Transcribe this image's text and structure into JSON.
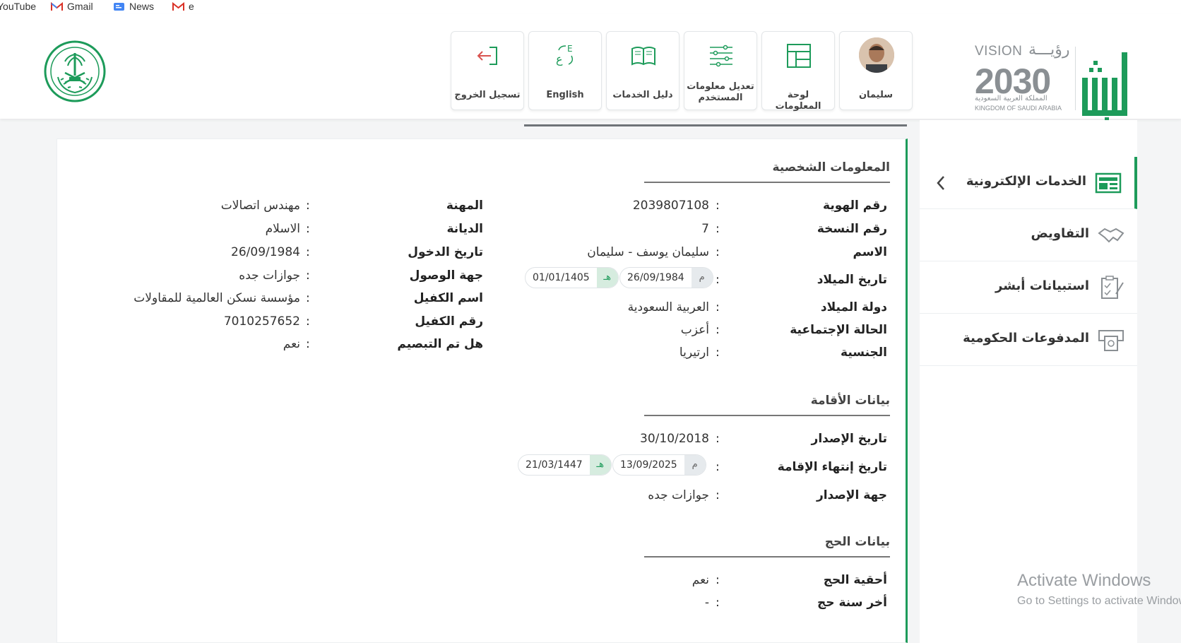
{
  "bookmarks": [
    {
      "label": "YouTube",
      "icon": "youtube-icon"
    },
    {
      "label": "Gmail",
      "icon": "gmail-icon"
    },
    {
      "label": "News",
      "icon": "news-icon"
    },
    {
      "label": "e",
      "icon": "gmail-icon"
    }
  ],
  "brand": {
    "vision_word": "VISION",
    "vision_ar": "رؤيـــة",
    "vision_year": "2030",
    "kingdom_ar": "المملكة العربية السعودية",
    "kingdom_en": "KINGDOM OF SAUDI ARABIA",
    "accent": "#1d9b5a"
  },
  "tiles": {
    "user": "سليمان",
    "dashboard": "لوحة المعلومات",
    "edit_info": "تعديل معلومات المستخدم",
    "services_guide": "دليل الخدمات",
    "language": "English",
    "logout": "تسجيل الخروج"
  },
  "sidebar": {
    "items": [
      {
        "label": "الخدمات الإلكترونية",
        "icon": "eservices-icon"
      },
      {
        "label": "التفاويض",
        "icon": "handshake-icon"
      },
      {
        "label": "استبيانات أبشر",
        "icon": "survey-icon"
      },
      {
        "label": "المدفوعات الحكومية",
        "icon": "payments-icon"
      }
    ]
  },
  "personal": {
    "title": "المعلومات الشخصية",
    "id_label": "رقم الهوية",
    "id_value": "2039807108",
    "copy_label": "رقم النسخة",
    "copy_value": "7",
    "name_label": "الاسم",
    "name_value": "سليمان يوسف - سليمان",
    "dob_label": "تاريخ الميلاد",
    "dob_greg_tag": "م",
    "dob_greg": "26/09/1984",
    "dob_hijri_tag": "هـ",
    "dob_hijri": "01/01/1405",
    "birth_country_label": "دولة الميلاد",
    "birth_country_value": "العربية السعودية",
    "marital_label": "الحالة الإجتماعية",
    "marital_value": "أعزب",
    "nationality_label": "الجنسية",
    "nationality_value": "ارتيريا",
    "occupation_label": "المهنة",
    "occupation_value": "مهندس اتصالات",
    "religion_label": "الديانة",
    "religion_value": "الاسلام",
    "entry_label": "تاريخ الدخول",
    "entry_value": "26/09/1984",
    "arrival_label": "جهة الوصول",
    "arrival_value": "جوازات جده",
    "sponsor_label": "اسم الكفيل",
    "sponsor_value": "مؤسسة نسكن العالمية للمقاولات",
    "sponsor_no_label": "رقم الكفيل",
    "sponsor_no_value": "7010257652",
    "fingerprint_label": "هل تم التبصيم",
    "fingerprint_value": "نعم"
  },
  "residence": {
    "title": "بيانات الأقامة",
    "issue_label": "تاريخ الإصدار",
    "issue_value": "30/10/2018",
    "expiry_label": "تاريخ إنتهاء الإقامة",
    "expiry_greg_tag": "م",
    "expiry_greg": "13/09/2025",
    "expiry_hijri_tag": "هـ",
    "expiry_hijri": "21/03/1447",
    "authority_label": "جهة الإصدار",
    "authority_value": "جوازات جده"
  },
  "hajj": {
    "title": "بيانات الحج",
    "eligible_label": "أحقية الحج",
    "eligible_value": "نعم",
    "last_label": "أخر سنة حج",
    "last_value": "-"
  },
  "os": {
    "activate_title": "Activate Windows",
    "activate_sub": "Go to Settings to activate Windows."
  }
}
